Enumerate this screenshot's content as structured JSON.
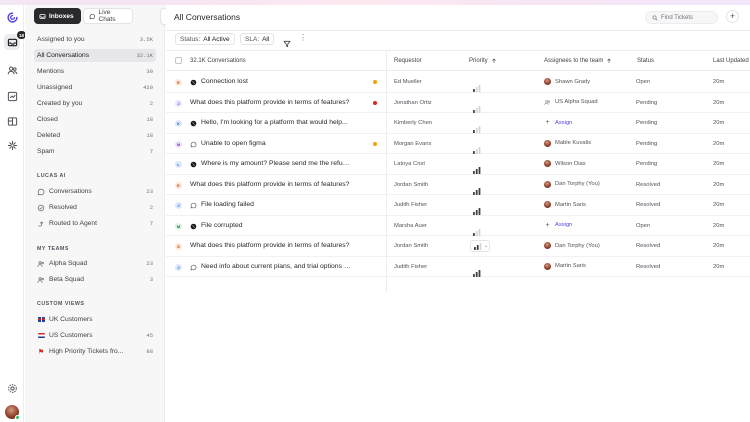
{
  "rail": {
    "inbox_badge": "18",
    "icons": [
      "logo-icon",
      "inbox-icon",
      "contacts-icon",
      "reports-icon",
      "library-icon",
      "integrations-icon",
      "settings-icon"
    ]
  },
  "sidebar": {
    "tabs": {
      "inboxes": "Inboxes",
      "live_chats": "Live Chats"
    },
    "items": [
      {
        "label": "Assigned to you",
        "count": "3.5K"
      },
      {
        "label": "All Conversations",
        "count": "32.1K"
      },
      {
        "label": "Mentions",
        "count": "30"
      },
      {
        "label": "Unassigned",
        "count": "420"
      },
      {
        "label": "Created by you",
        "count": "2"
      },
      {
        "label": "Closed",
        "count": "18"
      },
      {
        "label": "Deleted",
        "count": "18"
      },
      {
        "label": "Spam",
        "count": "7"
      }
    ],
    "lucas_title": "Lucas AI",
    "lucas_items": [
      {
        "label": "Conversations",
        "count": "23"
      },
      {
        "label": "Resolved",
        "count": "2"
      },
      {
        "label": "Routed to Agent",
        "count": "7"
      }
    ],
    "teams_title": "My Teams",
    "team_items": [
      {
        "label": "Alpha Squad",
        "count": "23"
      },
      {
        "label": "Beta Squad",
        "count": "3"
      }
    ],
    "views_title": "Custom Views",
    "view_items": [
      {
        "label": "UK Customers",
        "count": ""
      },
      {
        "label": "US Customers",
        "count": "45"
      },
      {
        "label": "High Priority Tickets fro...",
        "count": "88"
      }
    ]
  },
  "header": {
    "title": "All Conversations",
    "search_placeholder": "Find Tickets"
  },
  "filters": {
    "status_label": "Status:",
    "status_value": "All Active",
    "sla_label": "SLA:",
    "sla_value": "All"
  },
  "table": {
    "columns": {
      "conversations": "32.1K Conversations",
      "requestor": "Requestor",
      "priority": "Priority",
      "assignee": "Assignees to the team",
      "status": "Status",
      "last_updated": "Last Updated"
    },
    "rows": [
      {
        "initial": "E",
        "avatar_color": "#fde7d6",
        "avatar_text": "#c2410c",
        "channel": "whatsapp",
        "subject": "Connection lost",
        "dot": "#f59e0b",
        "requestor": "Ed Mueller",
        "priority": 1,
        "assignee": "Shawn Grady",
        "assignee_type": "person",
        "status": "Open",
        "updated": "20m"
      },
      {
        "initial": "J",
        "avatar_color": "#ede4fb",
        "avatar_text": "#7c3aed",
        "channel": "none",
        "subject": "What does this platform provide in terms of features?",
        "dot": "#dc2626",
        "requestor": "Jonathan Ortiz",
        "priority": 1,
        "assignee": "US Alpha Squad",
        "assignee_type": "team",
        "status": "Pending",
        "updated": "20m"
      },
      {
        "initial": "K",
        "avatar_color": "#dce8fb",
        "avatar_text": "#2563eb",
        "channel": "whatsapp",
        "subject": "Hello, I'm looking for a platform that would help...",
        "dot": "",
        "requestor": "Kimberly Chen",
        "priority": 1,
        "assignee": "Assign",
        "assignee_type": "assign",
        "status": "Pending",
        "updated": "20m"
      },
      {
        "initial": "M",
        "avatar_color": "#ede4fb",
        "avatar_text": "#7c3aed",
        "channel": "chat",
        "subject": "Unable to open figma",
        "dot": "#f59e0b",
        "requestor": "Morgan Evans",
        "priority": 1,
        "assignee": "Mable Kuvalis",
        "assignee_type": "person",
        "status": "Pending",
        "updated": "20m"
      },
      {
        "initial": "L",
        "avatar_color": "#dce8fb",
        "avatar_text": "#2563eb",
        "channel": "whatsapp",
        "subject": "Where is my amount? Please send me the refund...",
        "dot": "",
        "requestor": "Latoya Crist",
        "priority": 3,
        "assignee": "Wilson Dias",
        "assignee_type": "person",
        "status": "Pending",
        "updated": "20m"
      },
      {
        "initial": "E",
        "avatar_color": "#fde7d6",
        "avatar_text": "#c2410c",
        "channel": "none",
        "subject": "What does this platform provide in terms of features?",
        "dot": "",
        "requestor": "Jordan Smith",
        "priority": 3,
        "assignee": "Dan Torphy (You)",
        "assignee_type": "person",
        "status": "Resolved",
        "updated": "20m"
      },
      {
        "initial": "J",
        "avatar_color": "#dce8fb",
        "avatar_text": "#2563eb",
        "channel": "chat",
        "subject": "File loading failed",
        "dot": "",
        "requestor": "Judith Fisher",
        "priority": 3,
        "assignee": "Martin Saris",
        "assignee_type": "person",
        "status": "Resolved",
        "updated": "20m"
      },
      {
        "initial": "M",
        "avatar_color": "#dcf3e6",
        "avatar_text": "#15803d",
        "channel": "whatsapp",
        "subject": "File corrupted",
        "dot": "",
        "requestor": "Marsha Auer",
        "priority": 1,
        "assignee": "Assign",
        "assignee_type": "assign",
        "status": "Open",
        "updated": "20m"
      },
      {
        "initial": "S",
        "avatar_color": "#fde7d6",
        "avatar_text": "#c2410c",
        "channel": "none",
        "subject": "What does this platform provide in terms of features?",
        "dot": "",
        "requestor": "Jordan Smith",
        "priority": 2,
        "assignee": "Dan Torphy (You)",
        "assignee_type": "person",
        "status": "Resolved",
        "updated": "20m",
        "priority_select": true
      },
      {
        "initial": "J",
        "avatar_color": "#dce8fb",
        "avatar_text": "#2563eb",
        "channel": "chat",
        "subject": "Need info about current plans, and trial options fo...",
        "dot": "",
        "requestor": "Judith Fisher",
        "priority": 3,
        "assignee": "Martin Saris",
        "assignee_type": "person",
        "status": "Resolved",
        "updated": "20m"
      }
    ]
  }
}
